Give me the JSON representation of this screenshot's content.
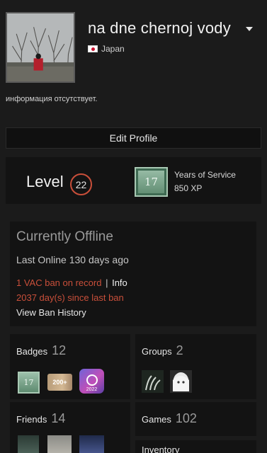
{
  "profile": {
    "username": "na dne chernoj vody",
    "country": "Japan",
    "summary": "информация отсутствует.",
    "edit_button": "Edit Profile"
  },
  "level": {
    "label": "Level",
    "value": "22",
    "badge_number": "17",
    "badge_title": "Years of Service",
    "badge_xp": "850 XP"
  },
  "status": {
    "title": "Currently Offline",
    "last_online": "Last Online 130 days ago",
    "vac_text": "1 VAC ban on record",
    "vac_sep": "|",
    "vac_info": "Info",
    "ban_days": "2037 day(s) since last ban",
    "ban_history": "View Ban History"
  },
  "tiles": {
    "badges": {
      "label": "Badges",
      "count": "12",
      "badge1": "17",
      "badge2": "200+",
      "badge3_year": "2022"
    },
    "groups": {
      "label": "Groups",
      "count": "2"
    },
    "friends": {
      "label": "Friends",
      "count": "14"
    },
    "games": {
      "label": "Games",
      "count": "102"
    },
    "inventory": {
      "label": "Inventory"
    }
  },
  "colors": {
    "background": "#1b1b1b",
    "panel": "#131313",
    "vac_red": "#c94f3a",
    "level_ring": "#c94f3a"
  }
}
